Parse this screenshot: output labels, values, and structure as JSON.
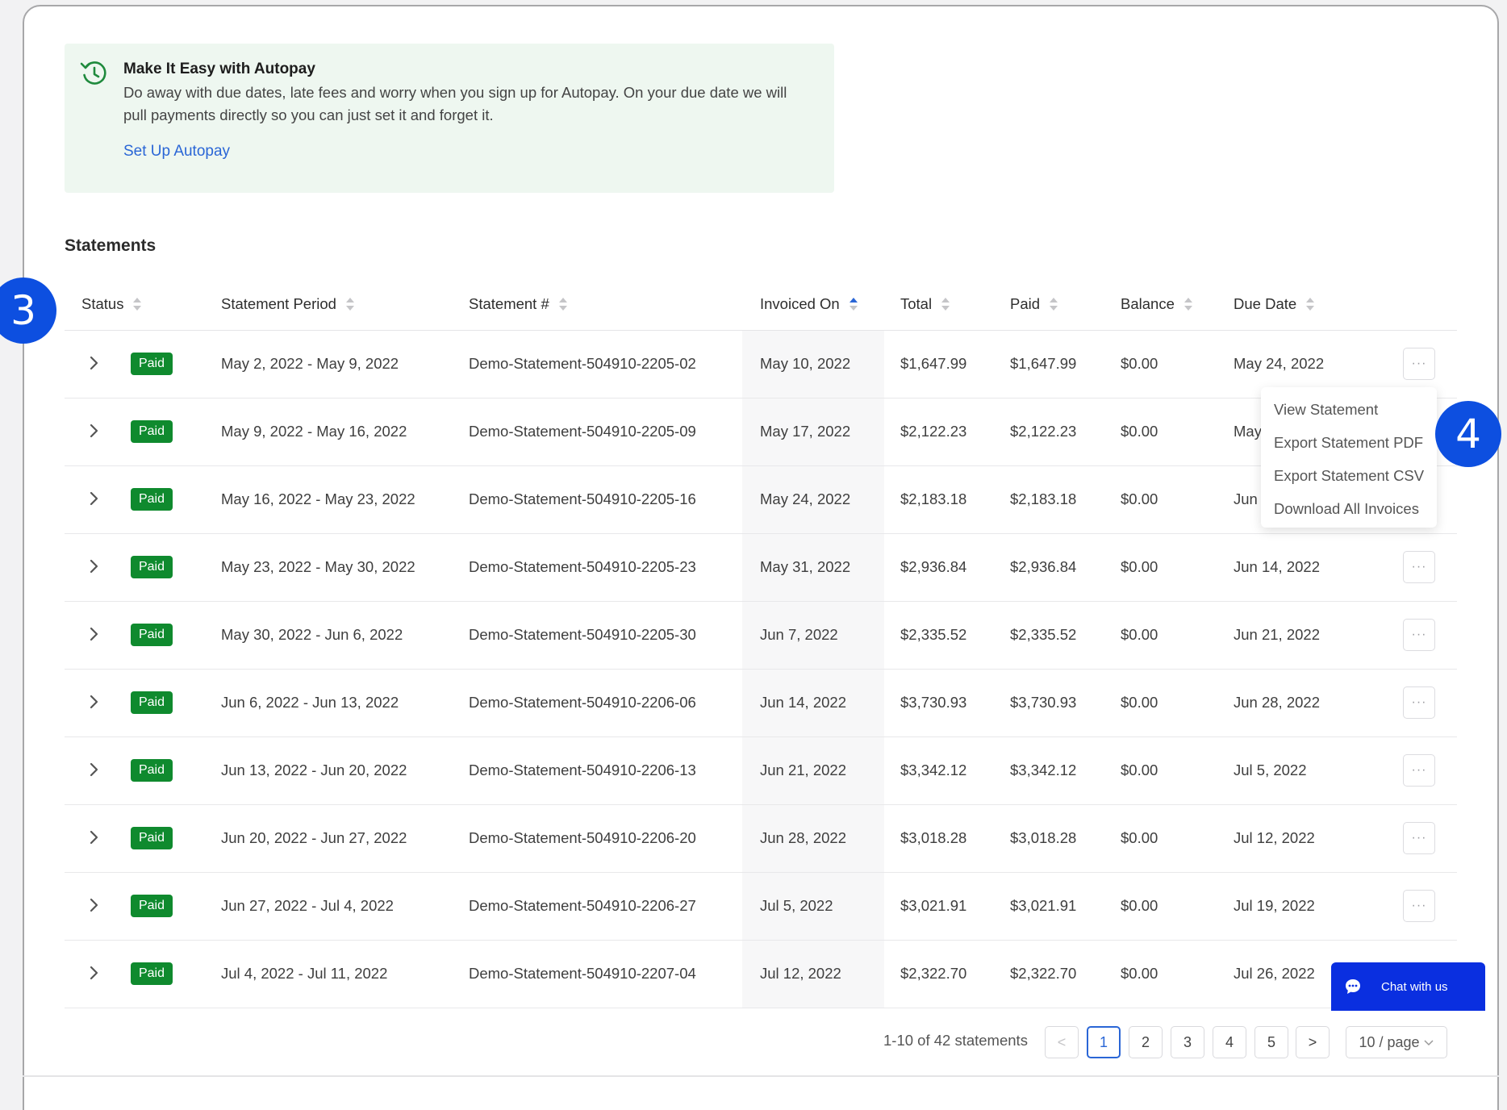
{
  "banner": {
    "title": "Make It Easy with Autopay",
    "text": "Do away with due dates, late fees and worry when you sign up for Autopay. On your due date we will pull payments directly so you can just set it and forget it.",
    "link": "Set Up Autopay"
  },
  "section_title": "Statements",
  "columns": [
    "Status",
    "Statement Period",
    "Statement #",
    "Invoiced On",
    "Total",
    "Paid",
    "Balance",
    "Due Date"
  ],
  "sorted_column": "Invoiced On",
  "rows": [
    {
      "status": "Paid",
      "period": "May 2, 2022 - May 9, 2022",
      "number": "Demo-Statement-504910-2205-02",
      "invoiced": "May 10, 2022",
      "total": "$1,647.99",
      "paid": "$1,647.99",
      "balance": "$0.00",
      "due": "May 24, 2022"
    },
    {
      "status": "Paid",
      "period": "May 9, 2022 - May 16, 2022",
      "number": "Demo-Statement-504910-2205-09",
      "invoiced": "May 17, 2022",
      "total": "$2,122.23",
      "paid": "$2,122.23",
      "balance": "$0.00",
      "due": "May"
    },
    {
      "status": "Paid",
      "period": "May 16, 2022 - May 23, 2022",
      "number": "Demo-Statement-504910-2205-16",
      "invoiced": "May 24, 2022",
      "total": "$2,183.18",
      "paid": "$2,183.18",
      "balance": "$0.00",
      "due": "Jun"
    },
    {
      "status": "Paid",
      "period": "May 23, 2022 - May 30, 2022",
      "number": "Demo-Statement-504910-2205-23",
      "invoiced": "May 31, 2022",
      "total": "$2,936.84",
      "paid": "$2,936.84",
      "balance": "$0.00",
      "due": "Jun 14, 2022"
    },
    {
      "status": "Paid",
      "period": "May 30, 2022 - Jun 6, 2022",
      "number": "Demo-Statement-504910-2205-30",
      "invoiced": "Jun 7, 2022",
      "total": "$2,335.52",
      "paid": "$2,335.52",
      "balance": "$0.00",
      "due": "Jun 21, 2022"
    },
    {
      "status": "Paid",
      "period": "Jun 6, 2022 - Jun 13, 2022",
      "number": "Demo-Statement-504910-2206-06",
      "invoiced": "Jun 14, 2022",
      "total": "$3,730.93",
      "paid": "$3,730.93",
      "balance": "$0.00",
      "due": "Jun 28, 2022"
    },
    {
      "status": "Paid",
      "period": "Jun 13, 2022 - Jun 20, 2022",
      "number": "Demo-Statement-504910-2206-13",
      "invoiced": "Jun 21, 2022",
      "total": "$3,342.12",
      "paid": "$3,342.12",
      "balance": "$0.00",
      "due": "Jul 5, 2022"
    },
    {
      "status": "Paid",
      "period": "Jun 20, 2022 - Jun 27, 2022",
      "number": "Demo-Statement-504910-2206-20",
      "invoiced": "Jun 28, 2022",
      "total": "$3,018.28",
      "paid": "$3,018.28",
      "balance": "$0.00",
      "due": "Jul 12, 2022"
    },
    {
      "status": "Paid",
      "period": "Jun 27, 2022 - Jul 4, 2022",
      "number": "Demo-Statement-504910-2206-27",
      "invoiced": "Jul 5, 2022",
      "total": "$3,021.91",
      "paid": "$3,021.91",
      "balance": "$0.00",
      "due": "Jul 19, 2022"
    },
    {
      "status": "Paid",
      "period": "Jul 4, 2022 - Jul 11, 2022",
      "number": "Demo-Statement-504910-2207-04",
      "invoiced": "Jul 12, 2022",
      "total": "$2,322.70",
      "paid": "$2,322.70",
      "balance": "$0.00",
      "due": "Jul 26, 2022"
    }
  ],
  "menu": [
    "View Statement",
    "Export Statement PDF",
    "Export Statement CSV",
    "Download All Invoices"
  ],
  "callouts": {
    "left": "3",
    "right": "4"
  },
  "pagination": {
    "info": "1-10 of 42 statements",
    "pages": [
      "1",
      "2",
      "3",
      "4",
      "5"
    ],
    "current": "1",
    "prev": "<",
    "next": ">",
    "page_size": "10 / page"
  },
  "more_glyph": "···",
  "chat_label": "Chat with us",
  "colors": {
    "accent": "#2a66d6",
    "paid_badge": "#0f8a2e",
    "banner_bg": "#eef7f0",
    "callout": "#0d4fe0",
    "chat": "#0a2fe0"
  }
}
